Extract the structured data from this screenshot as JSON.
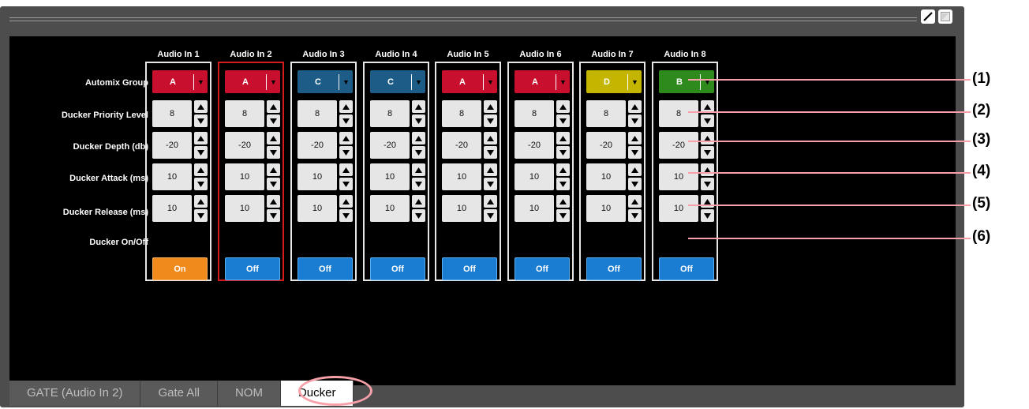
{
  "columns": [
    {
      "title": "Audio In 1",
      "group": "A",
      "group_color": "#c8102e",
      "priority": "8",
      "depth": "-20",
      "attack": "10",
      "release": "10",
      "ducker": "On",
      "ducker_state": "on"
    },
    {
      "title": "Audio In 2",
      "group": "A",
      "group_color": "#c8102e",
      "priority": "8",
      "depth": "-20",
      "attack": "10",
      "release": "10",
      "ducker": "Off",
      "ducker_state": "off"
    },
    {
      "title": "Audio In 3",
      "group": "C",
      "group_color": "#1d5c86",
      "priority": "8",
      "depth": "-20",
      "attack": "10",
      "release": "10",
      "ducker": "Off",
      "ducker_state": "off"
    },
    {
      "title": "Audio In 4",
      "group": "C",
      "group_color": "#1d5c86",
      "priority": "8",
      "depth": "-20",
      "attack": "10",
      "release": "10",
      "ducker": "Off",
      "ducker_state": "off"
    },
    {
      "title": "Audio In 5",
      "group": "A",
      "group_color": "#c8102e",
      "priority": "8",
      "depth": "-20",
      "attack": "10",
      "release": "10",
      "ducker": "Off",
      "ducker_state": "off"
    },
    {
      "title": "Audio In 6",
      "group": "A",
      "group_color": "#c8102e",
      "priority": "8",
      "depth": "-20",
      "attack": "10",
      "release": "10",
      "ducker": "Off",
      "ducker_state": "off"
    },
    {
      "title": "Audio In 7",
      "group": "D",
      "group_color": "#c4b600",
      "priority": "8",
      "depth": "-20",
      "attack": "10",
      "release": "10",
      "ducker": "Off",
      "ducker_state": "off"
    },
    {
      "title": "Audio In 8",
      "group": "B",
      "group_color": "#2f8a1d",
      "priority": "8",
      "depth": "-20",
      "attack": "10",
      "release": "10",
      "ducker": "Off",
      "ducker_state": "off"
    }
  ],
  "selected_column": 1,
  "row_labels": {
    "automix_group": "Automix Group",
    "priority": "Ducker Priority Level",
    "depth": "Ducker Depth (db)",
    "attack": "Ducker Attack (ms)",
    "release": "Ducker Release (ms)",
    "onoff": "Ducker On/Off"
  },
  "tabs": [
    "GATE (Audio In 2)",
    "Gate All",
    "NOM",
    "Ducker"
  ],
  "active_tab": "Ducker",
  "callouts": [
    "(1)",
    "(2)",
    "(3)",
    "(4)",
    "(5)",
    "(6)"
  ],
  "icons": {
    "edit": "pencil-icon",
    "window": "window-icon"
  }
}
